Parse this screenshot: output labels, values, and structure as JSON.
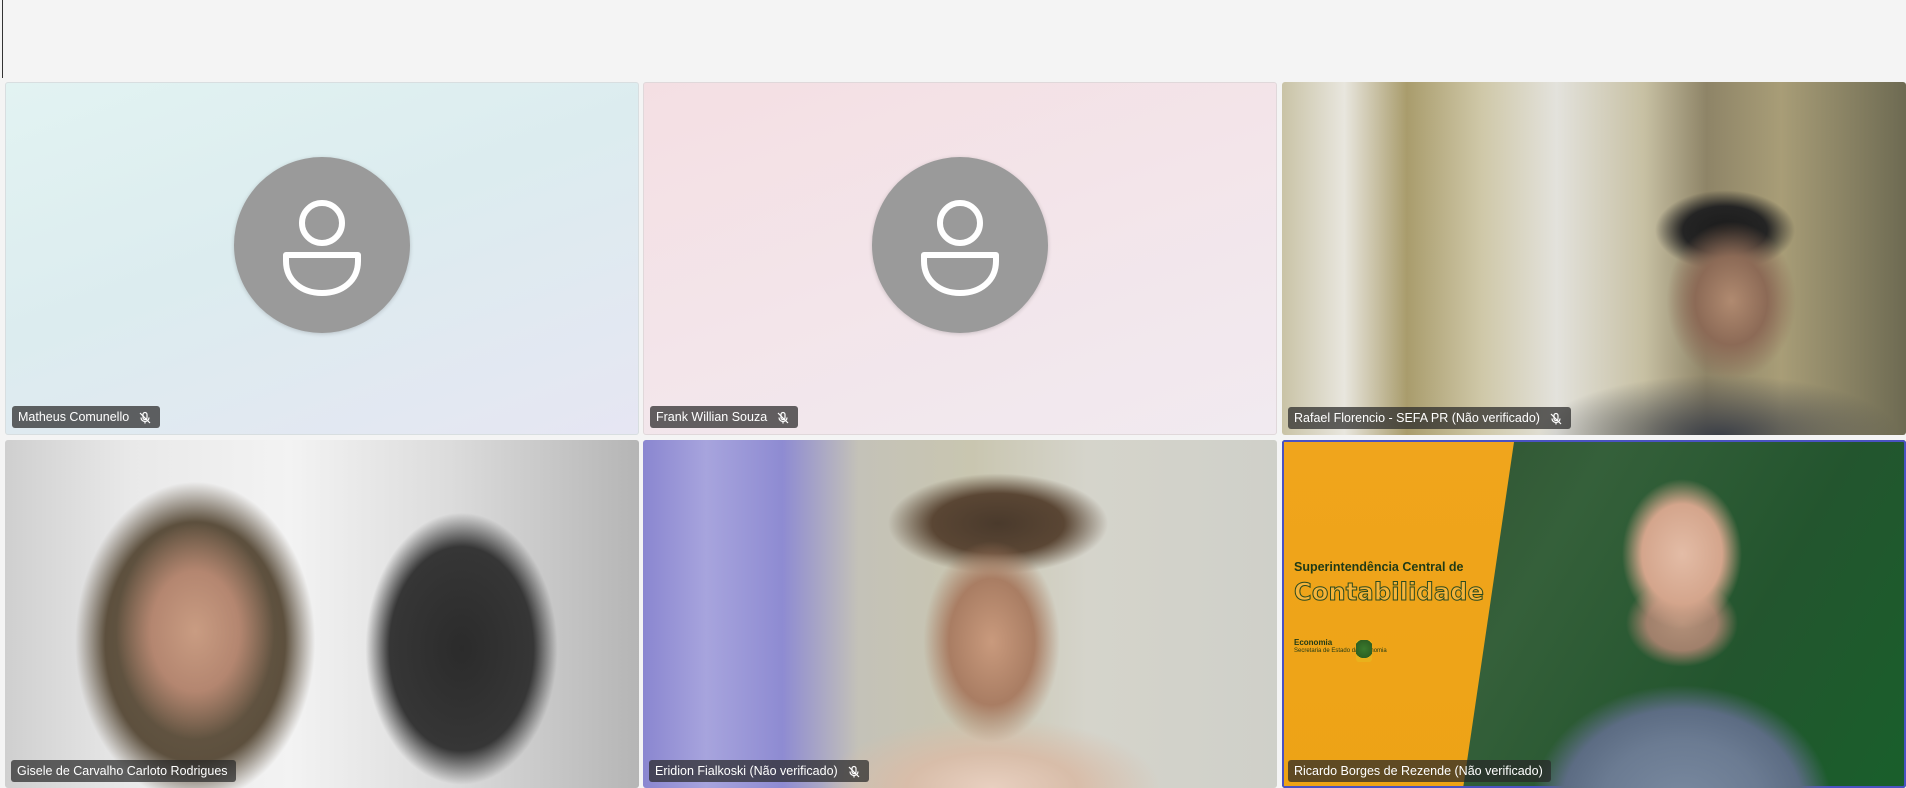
{
  "participants": [
    {
      "name": "Matheus Comunello",
      "muted": true,
      "video": false
    },
    {
      "name": "Frank Willian Souza",
      "muted": true,
      "video": false
    },
    {
      "name": "Rafael Florencio - SEFA PR (Não verificado)",
      "muted": true,
      "video": true
    },
    {
      "name": "Gisele de Carvalho Carloto Rodrigues",
      "muted": false,
      "video": true
    },
    {
      "name": "Eridion Fialkoski (Não verificado)",
      "muted": true,
      "video": true
    },
    {
      "name": "Ricardo Borges de Rezende (Não verificado)",
      "muted": false,
      "video": true,
      "active_speaker": true
    }
  ],
  "banner": {
    "line1": "Superintendência Central de",
    "line2": "Contabilidade",
    "org": "Economia",
    "org_sub": "Secretaria de Estado da Economia"
  },
  "icons": {
    "avatar": "person-icon",
    "mute": "mic-off-icon"
  },
  "colors": {
    "active_speaker_outline": "#4a52c2",
    "label_bg": "#282828",
    "avatar_bg": "#9a9a9a",
    "banner_yellow": "#f0a51c",
    "banner_green": "#1f3a16"
  }
}
